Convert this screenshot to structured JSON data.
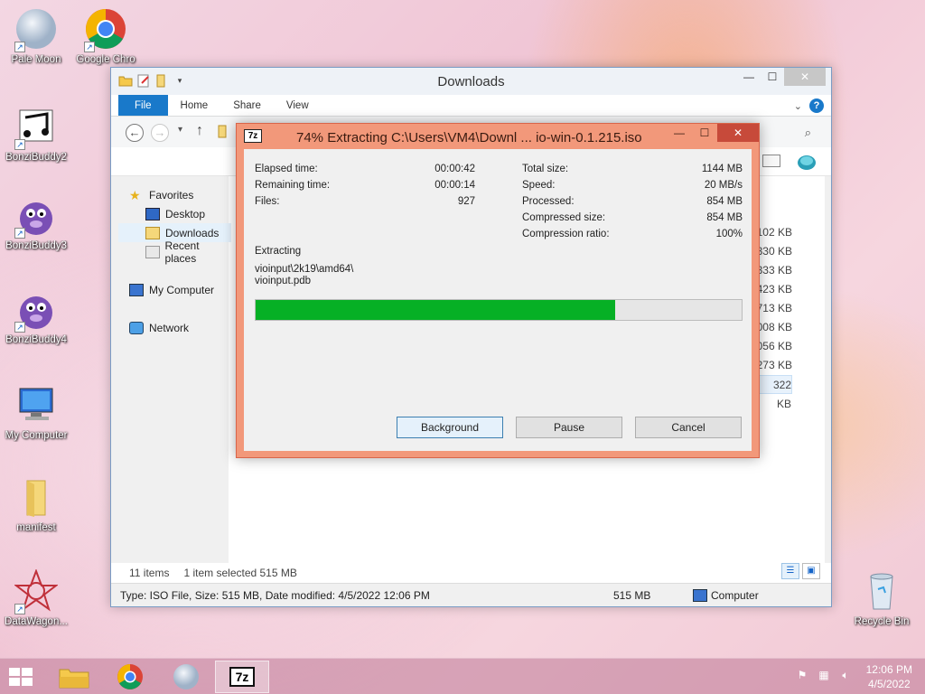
{
  "desktop": {
    "icons": [
      {
        "label": "Pale Moon"
      },
      {
        "label": "Google Chro"
      },
      {
        "label": "BonziBuddy2"
      },
      {
        "label": "BonziBuddy3"
      },
      {
        "label": "BonziBuddy4"
      },
      {
        "label": "My Computer"
      },
      {
        "label": "manifest"
      },
      {
        "label": "DataWagon..."
      },
      {
        "label": "Recycle Bin"
      }
    ]
  },
  "explorer": {
    "title": "Downloads",
    "tabs": [
      "File",
      "Home",
      "Share",
      "View"
    ],
    "nav": {
      "favorites": "Favorites",
      "desktop": "Desktop",
      "downloads": "Downloads",
      "recent": "Recent places",
      "my_computer": "My Computer",
      "network": "Network"
    },
    "sizes": [
      "102 KB",
      "330 KB",
      "333 KB",
      "423 KB",
      "713 KB",
      "008 KB",
      "056 KB",
      "273 KB",
      "322 KB"
    ],
    "status": {
      "items": "11 items",
      "selected": "1 item selected  515 MB"
    },
    "details": {
      "info": "Type: ISO File, Size: 515 MB, Date modified: 4/5/2022 12:06 PM",
      "size": "515 MB",
      "location": "Computer"
    }
  },
  "zip_dialog": {
    "title": "74% Extracting C:\\Users\\VM4\\Downl ... io-win-0.1.215.iso",
    "logo": "7z",
    "elapsed_label": "Elapsed time:",
    "elapsed_value": "00:00:42",
    "remaining_label": "Remaining time:",
    "remaining_value": "00:00:14",
    "files_label": "Files:",
    "files_value": "927",
    "total_label": "Total size:",
    "total_value": "1144 MB",
    "speed_label": "Speed:",
    "speed_value": "20 MB/s",
    "processed_label": "Processed:",
    "processed_value": "854 MB",
    "compressed_label": "Compressed size:",
    "compressed_value": "854 MB",
    "ratio_label": "Compression ratio:",
    "ratio_value": "100%",
    "extracting_label": "Extracting",
    "current_path": "vioinput\\2k19\\amd64\\",
    "current_file": "vioinput.pdb",
    "progress": 0.74,
    "buttons": {
      "background": "Background",
      "pause": "Pause",
      "cancel": "Cancel"
    }
  },
  "taskbar": {
    "clock_time": "12:06 PM",
    "clock_date": "4/5/2022",
    "active_app": "7z"
  },
  "colors": {
    "accent": "#1979ca",
    "progress_fill": "#06b025",
    "dialog_frame": "#f2987a"
  }
}
